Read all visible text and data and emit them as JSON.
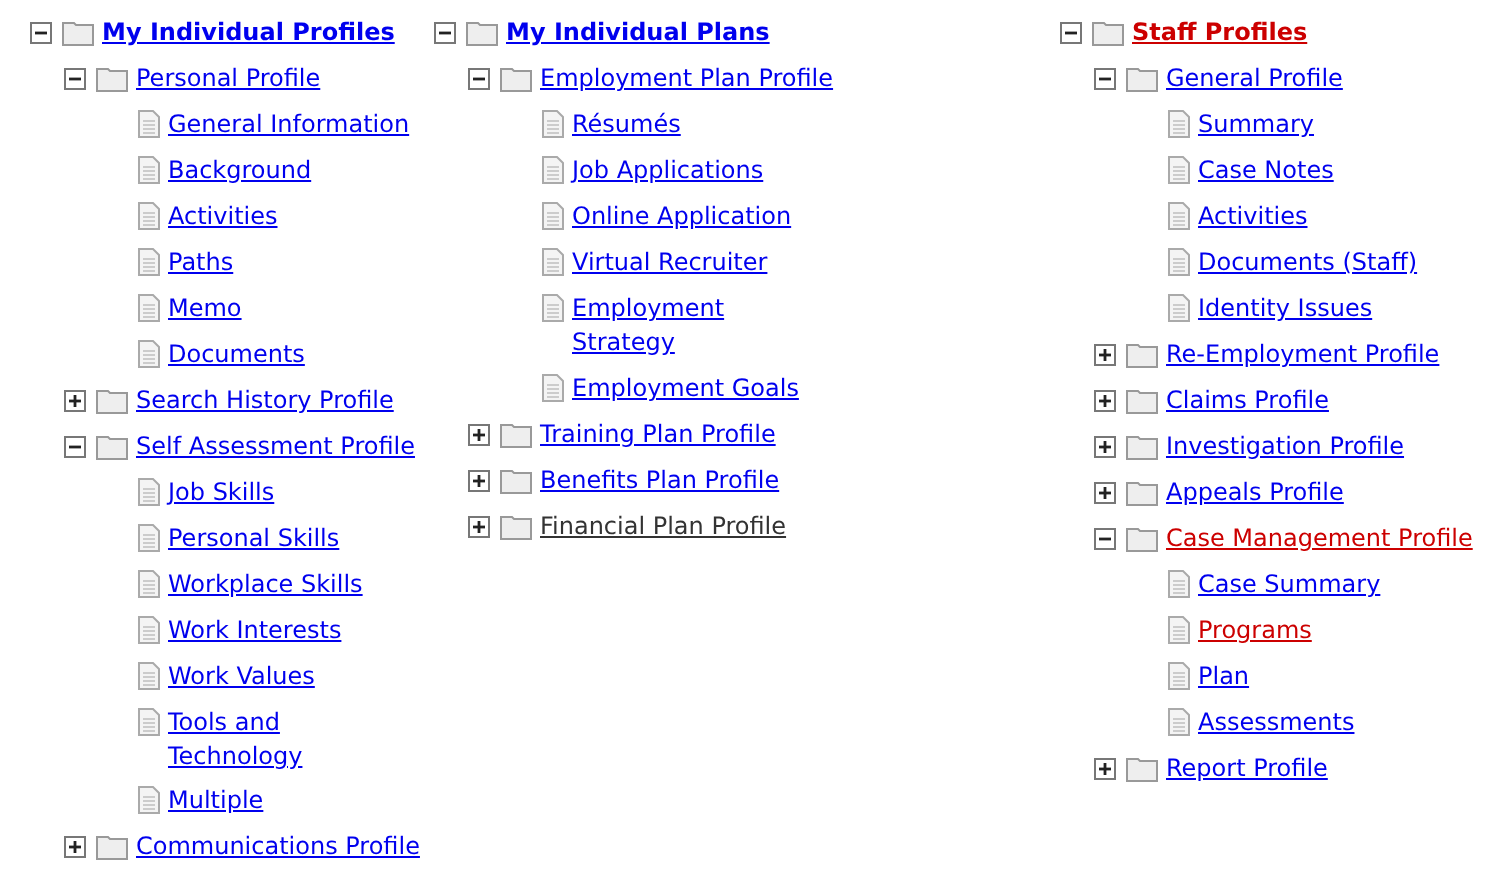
{
  "columns": [
    {
      "label": "My Individual Profiles",
      "kind": "folder",
      "expanded": true,
      "color": "#0000ee",
      "children": [
        {
          "label": "Personal Profile",
          "kind": "folder",
          "expanded": true,
          "color": "#0000ee",
          "children": [
            {
              "label": "General Information",
              "kind": "page",
              "color": "#0000ee"
            },
            {
              "label": "Background",
              "kind": "page",
              "color": "#0000ee"
            },
            {
              "label": "Activities",
              "kind": "page",
              "color": "#0000ee"
            },
            {
              "label": "Paths",
              "kind": "page",
              "color": "#0000ee"
            },
            {
              "label": "Memo",
              "kind": "page",
              "color": "#0000ee"
            },
            {
              "label": "Documents",
              "kind": "page",
              "color": "#0000ee"
            }
          ]
        },
        {
          "label": "Search History Profile",
          "kind": "folder",
          "expanded": false,
          "color": "#0000ee"
        },
        {
          "label": "Self Assessment Profile",
          "kind": "folder",
          "expanded": true,
          "color": "#0000ee",
          "children": [
            {
              "label": "Job Skills",
              "kind": "page",
              "color": "#0000ee"
            },
            {
              "label": "Personal Skills",
              "kind": "page",
              "color": "#0000ee"
            },
            {
              "label": "Workplace Skills",
              "kind": "page",
              "color": "#0000ee"
            },
            {
              "label": "Work Interests",
              "kind": "page",
              "color": "#0000ee"
            },
            {
              "label": "Work Values",
              "kind": "page",
              "color": "#0000ee"
            },
            {
              "label": "Tools and\nTechnology",
              "kind": "page",
              "color": "#0000ee"
            },
            {
              "label": "Multiple",
              "kind": "page",
              "color": "#0000ee"
            }
          ]
        },
        {
          "label": "Communications Profile",
          "kind": "folder",
          "expanded": false,
          "color": "#0000ee"
        }
      ]
    },
    {
      "label": "My Individual Plans",
      "kind": "folder",
      "expanded": true,
      "color": "#0000ee",
      "children": [
        {
          "label": "Employment Plan Profile",
          "kind": "folder",
          "expanded": true,
          "color": "#0000ee",
          "children": [
            {
              "label": "Résumés",
              "kind": "page",
              "color": "#0000ee"
            },
            {
              "label": "Job Applications",
              "kind": "page",
              "color": "#0000ee"
            },
            {
              "label": "Online Application",
              "kind": "page",
              "color": "#0000ee"
            },
            {
              "label": "Virtual Recruiter",
              "kind": "page",
              "color": "#0000ee"
            },
            {
              "label": "Employment\nStrategy",
              "kind": "page",
              "color": "#0000ee"
            },
            {
              "label": "Employment Goals",
              "kind": "page",
              "color": "#0000ee"
            }
          ]
        },
        {
          "label": "Training Plan Profile",
          "kind": "folder",
          "expanded": false,
          "color": "#0000ee"
        },
        {
          "label": "Benefits Plan Profile",
          "kind": "folder",
          "expanded": false,
          "color": "#0000ee"
        },
        {
          "label": "Financial Plan Profile",
          "kind": "folder",
          "expanded": false,
          "color": "#333333"
        }
      ]
    },
    {
      "label": "Staff Profiles",
      "kind": "folder",
      "expanded": true,
      "color": "#cc0000",
      "children": [
        {
          "label": "General Profile",
          "kind": "folder",
          "expanded": true,
          "color": "#0000ee",
          "children": [
            {
              "label": "Summary",
              "kind": "page",
              "color": "#0000ee"
            },
            {
              "label": "Case Notes",
              "kind": "page",
              "color": "#0000ee"
            },
            {
              "label": "Activities",
              "kind": "page",
              "color": "#0000ee"
            },
            {
              "label": "Documents (Staff)",
              "kind": "page",
              "color": "#0000ee"
            },
            {
              "label": "Identity Issues",
              "kind": "page",
              "color": "#0000ee"
            }
          ]
        },
        {
          "label": "Re-Employment Profile",
          "kind": "folder",
          "expanded": false,
          "color": "#0000ee"
        },
        {
          "label": "Claims Profile",
          "kind": "folder",
          "expanded": false,
          "color": "#0000ee"
        },
        {
          "label": "Investigation Profile",
          "kind": "folder",
          "expanded": false,
          "color": "#0000ee"
        },
        {
          "label": "Appeals Profile",
          "kind": "folder",
          "expanded": false,
          "color": "#0000ee"
        },
        {
          "label": "Case Management Profile",
          "kind": "folder",
          "expanded": true,
          "color": "#cc0000",
          "children": [
            {
              "label": "Case Summary",
              "kind": "page",
              "color": "#0000ee"
            },
            {
              "label": "Programs",
              "kind": "page",
              "color": "#cc0000"
            },
            {
              "label": "Plan",
              "kind": "page",
              "color": "#0000ee"
            },
            {
              "label": "Assessments",
              "kind": "page",
              "color": "#0000ee"
            }
          ]
        },
        {
          "label": "Report Profile",
          "kind": "folder",
          "expanded": false,
          "color": "#0000ee"
        }
      ]
    }
  ]
}
